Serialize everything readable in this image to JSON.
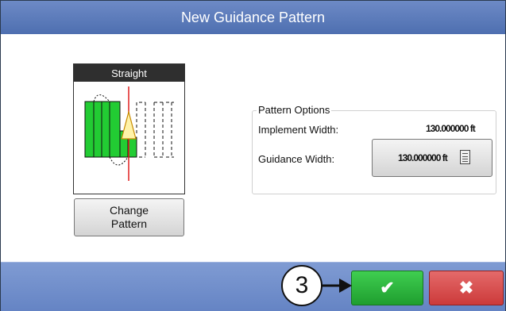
{
  "window": {
    "title": "New Guidance Pattern"
  },
  "pattern": {
    "name": "Straight",
    "change_button_line1": "Change",
    "change_button_line2": "Pattern"
  },
  "options": {
    "legend": "Pattern Options",
    "implement_width_label": "Implement Width:",
    "implement_width_value": "130.000000 ft",
    "guidance_width_label": "Guidance Width:",
    "guidance_width_value": "130.000000 ft"
  },
  "footer": {
    "callout_number": "3",
    "ok_icon": "checkmark-icon",
    "cancel_icon": "x-icon"
  },
  "colors": {
    "title_bar": "#5a7ab9",
    "footer": "#7391cd",
    "ok": "#2fb23f",
    "cancel": "#d84c4c",
    "swath_green": "#22cc33",
    "guide_line_red": "#e02020"
  }
}
